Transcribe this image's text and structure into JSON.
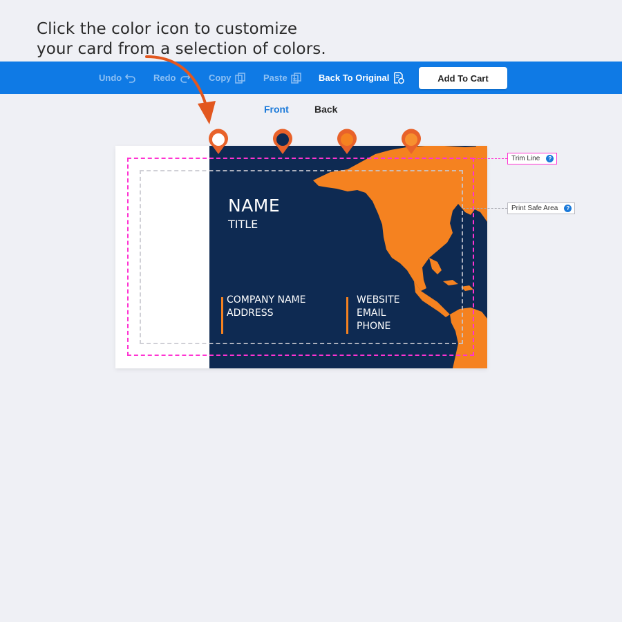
{
  "instruction": {
    "line1": "Click the color icon to customize",
    "line2": "your card from a selection of colors."
  },
  "toolbar": {
    "undo": "Undo",
    "redo": "Redo",
    "copy": "Copy",
    "paste": "Paste",
    "back_to_original": "Back To Original",
    "add_to_cart": "Add To Cart"
  },
  "tabs": {
    "front": "Front",
    "back": "Back",
    "active": "Front"
  },
  "swatches": [
    {
      "name": "white",
      "color": "#ffffff"
    },
    {
      "name": "navy",
      "color": "#0e2a52"
    },
    {
      "name": "orange",
      "color": "#f58220"
    },
    {
      "name": "orange-light",
      "color": "#f58220"
    }
  ],
  "card": {
    "name": "NAME",
    "title": "TITLE",
    "company": "COMPANY NAME",
    "address": "ADDRESS",
    "website": "WEBSITE",
    "email": "EMAIL",
    "phone": "PHONE",
    "colors": {
      "background": "#0e2a52",
      "map": "#f58220",
      "accent": "#f58220"
    }
  },
  "guides": {
    "trim_label": "Trim Line",
    "safe_label": "Print Safe Area"
  },
  "colors": {
    "toolbar": "#0f7ae5",
    "trim": "#ff33d2",
    "arrow": "#e2571f",
    "active_tab": "#1a79d9"
  }
}
